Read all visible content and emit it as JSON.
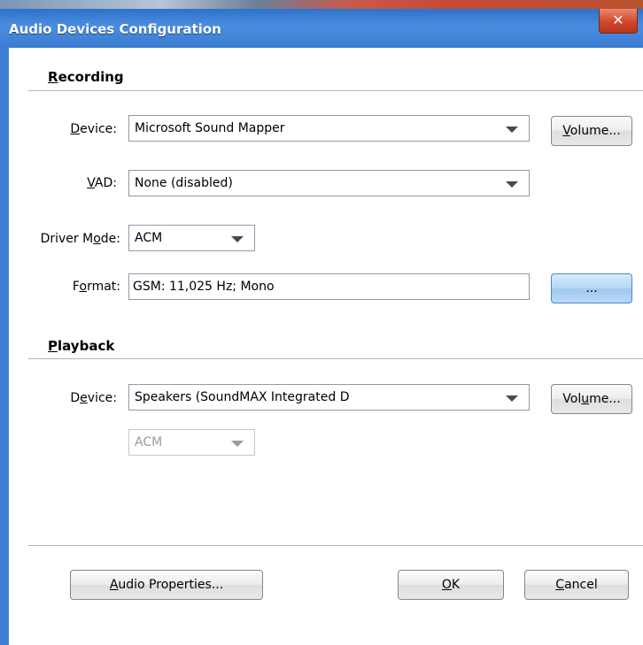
{
  "window": {
    "title": "Audio Devices Configuration",
    "close_glyph": "✕"
  },
  "recording": {
    "heading_first": "R",
    "heading_rest": "ecording",
    "device_label": {
      "pre": "",
      "key": "D",
      "post": "evice:"
    },
    "device_value": "Microsoft Sound Mapper",
    "volume_button": {
      "pre": "",
      "key": "V",
      "post": "olume..."
    },
    "vad_label": {
      "pre": "",
      "key": "V",
      "post": "AD:"
    },
    "vad_value": "None (disabled)",
    "driver_mode_label": {
      "pre": "Driver M",
      "key": "o",
      "post": "de:"
    },
    "driver_mode_value": "ACM",
    "format_label": {
      "pre": "F",
      "key": "o",
      "post": "rmat:"
    },
    "format_value": "GSM: 11,025 Hz; Mono",
    "format_button": "..."
  },
  "playback": {
    "heading_first": "P",
    "heading_rest": "layback",
    "device_label": {
      "pre": "D",
      "key": "e",
      "post": "vice:"
    },
    "device_value": "Speakers (SoundMAX Integrated D",
    "volume_button": {
      "pre": "Vol",
      "key": "u",
      "post": "me..."
    },
    "driver_mode_value": "ACM"
  },
  "footer": {
    "audio_properties": {
      "pre": "",
      "key": "A",
      "post": "udio Properties..."
    },
    "ok": {
      "pre": "",
      "key": "O",
      "post": "K"
    },
    "cancel": {
      "pre": "",
      "key": "C",
      "post": "ancel"
    }
  },
  "colors": {
    "titlebar": "#3a7bd0",
    "close": "#d2452a",
    "accent_button": "#b6d7f6"
  }
}
